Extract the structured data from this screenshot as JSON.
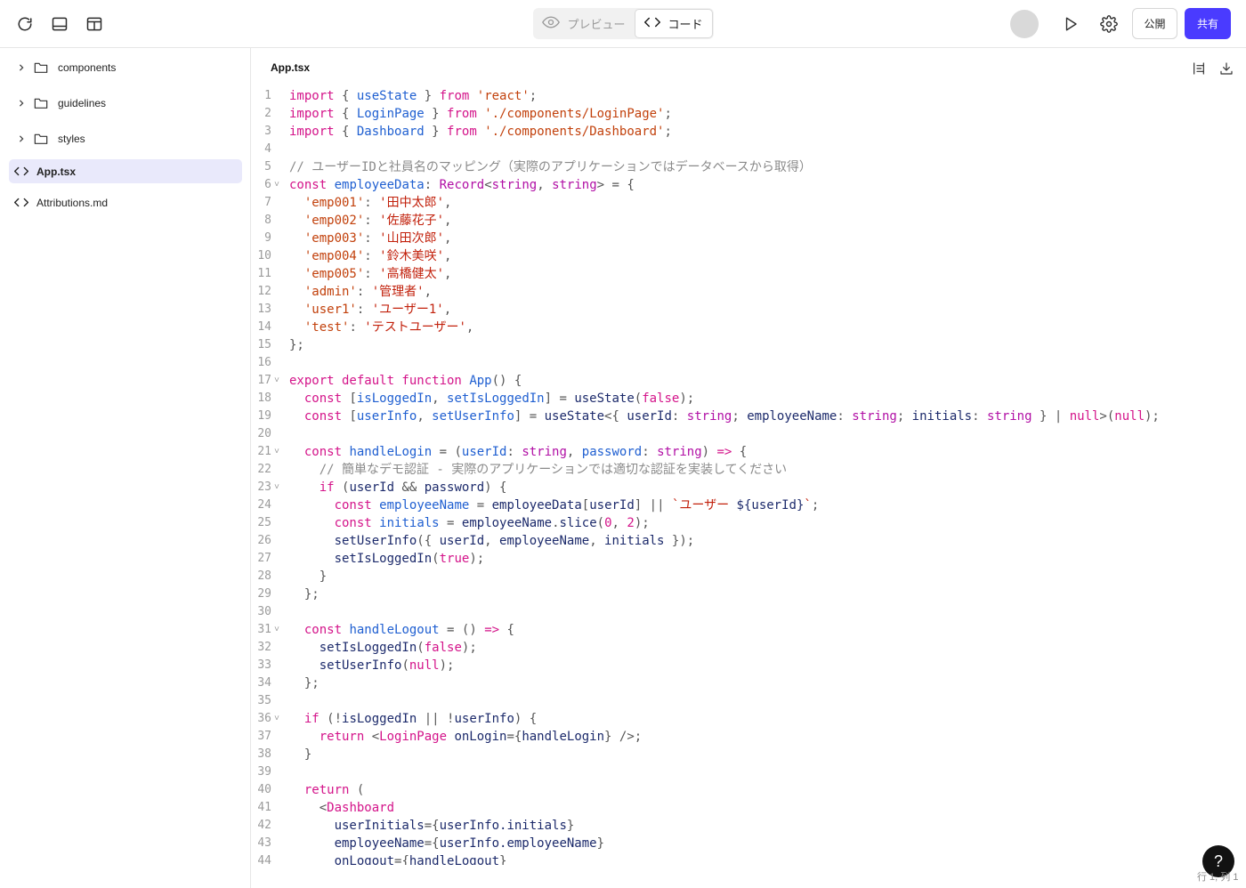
{
  "toolbar": {
    "preview_label": "プレビュー",
    "code_label": "コード",
    "publish_label": "公開",
    "share_label": "共有",
    "icons": [
      "refresh-icon",
      "panel-bottom-icon",
      "panel-split-icon",
      "eye-icon",
      "code-icon",
      "play-icon",
      "gear-icon"
    ]
  },
  "sidebar": {
    "items": [
      {
        "label": "components",
        "type": "folder",
        "expanded": false
      },
      {
        "label": "guidelines",
        "type": "folder",
        "expanded": false
      },
      {
        "label": "styles",
        "type": "folder",
        "expanded": false
      },
      {
        "label": "App.tsx",
        "type": "file",
        "active": true
      },
      {
        "label": "Attributions.md",
        "type": "file",
        "active": false
      }
    ]
  },
  "editor": {
    "filename": "App.tsx",
    "icons": [
      "format-icon",
      "download-icon"
    ],
    "lines": [
      {
        "n": "1",
        "fold": false,
        "tokens": [
          [
            "k",
            "import"
          ],
          [
            "p",
            " { "
          ],
          [
            "f",
            "useState"
          ],
          [
            "p",
            " } "
          ],
          [
            "k",
            "from"
          ],
          [
            "p",
            " "
          ],
          [
            "s",
            "'react'"
          ],
          [
            "p",
            ";"
          ]
        ]
      },
      {
        "n": "2",
        "fold": false,
        "tokens": [
          [
            "k",
            "import"
          ],
          [
            "p",
            " { "
          ],
          [
            "f",
            "LoginPage"
          ],
          [
            "p",
            " } "
          ],
          [
            "k",
            "from"
          ],
          [
            "p",
            " "
          ],
          [
            "s",
            "'./components/LoginPage'"
          ],
          [
            "p",
            ";"
          ]
        ]
      },
      {
        "n": "3",
        "fold": false,
        "tokens": [
          [
            "k",
            "import"
          ],
          [
            "p",
            " { "
          ],
          [
            "f",
            "Dashboard"
          ],
          [
            "p",
            " } "
          ],
          [
            "k",
            "from"
          ],
          [
            "p",
            " "
          ],
          [
            "s",
            "'./components/Dashboard'"
          ],
          [
            "p",
            ";"
          ]
        ]
      },
      {
        "n": "4",
        "fold": false,
        "tokens": []
      },
      {
        "n": "5",
        "fold": false,
        "tokens": [
          [
            "c",
            "// ユーザーIDと社員名のマッピング（実際のアプリケーションではデータベースから取得）"
          ]
        ]
      },
      {
        "n": "6",
        "fold": true,
        "tokens": [
          [
            "k",
            "const"
          ],
          [
            "p",
            " "
          ],
          [
            "f",
            "employeeData"
          ],
          [
            "p",
            ": "
          ],
          [
            "t",
            "Record"
          ],
          [
            "p",
            "<"
          ],
          [
            "t",
            "string"
          ],
          [
            "p",
            ", "
          ],
          [
            "t",
            "string"
          ],
          [
            "p",
            "> = {"
          ]
        ]
      },
      {
        "n": "7",
        "fold": false,
        "tokens": [
          [
            "p",
            "  "
          ],
          [
            "s",
            "'emp001'"
          ],
          [
            "p",
            ": "
          ],
          [
            "sj",
            "'田中太郎'"
          ],
          [
            "p",
            ","
          ]
        ]
      },
      {
        "n": "8",
        "fold": false,
        "tokens": [
          [
            "p",
            "  "
          ],
          [
            "s",
            "'emp002'"
          ],
          [
            "p",
            ": "
          ],
          [
            "sj",
            "'佐藤花子'"
          ],
          [
            "p",
            ","
          ]
        ]
      },
      {
        "n": "9",
        "fold": false,
        "tokens": [
          [
            "p",
            "  "
          ],
          [
            "s",
            "'emp003'"
          ],
          [
            "p",
            ": "
          ],
          [
            "sj",
            "'山田次郎'"
          ],
          [
            "p",
            ","
          ]
        ]
      },
      {
        "n": "10",
        "fold": false,
        "tokens": [
          [
            "p",
            "  "
          ],
          [
            "s",
            "'emp004'"
          ],
          [
            "p",
            ": "
          ],
          [
            "sj",
            "'鈴木美咲'"
          ],
          [
            "p",
            ","
          ]
        ]
      },
      {
        "n": "11",
        "fold": false,
        "tokens": [
          [
            "p",
            "  "
          ],
          [
            "s",
            "'emp005'"
          ],
          [
            "p",
            ": "
          ],
          [
            "sj",
            "'高橋健太'"
          ],
          [
            "p",
            ","
          ]
        ]
      },
      {
        "n": "12",
        "fold": false,
        "tokens": [
          [
            "p",
            "  "
          ],
          [
            "s",
            "'admin'"
          ],
          [
            "p",
            ": "
          ],
          [
            "sj",
            "'管理者'"
          ],
          [
            "p",
            ","
          ]
        ]
      },
      {
        "n": "13",
        "fold": false,
        "tokens": [
          [
            "p",
            "  "
          ],
          [
            "s",
            "'user1'"
          ],
          [
            "p",
            ": "
          ],
          [
            "sj",
            "'ユーザー1'"
          ],
          [
            "p",
            ","
          ]
        ]
      },
      {
        "n": "14",
        "fold": false,
        "tokens": [
          [
            "p",
            "  "
          ],
          [
            "s",
            "'test'"
          ],
          [
            "p",
            ": "
          ],
          [
            "sj",
            "'テストユーザー'"
          ],
          [
            "p",
            ","
          ]
        ]
      },
      {
        "n": "15",
        "fold": false,
        "tokens": [
          [
            "p",
            "};"
          ]
        ]
      },
      {
        "n": "16",
        "fold": false,
        "tokens": []
      },
      {
        "n": "17",
        "fold": true,
        "tokens": [
          [
            "k",
            "export default function"
          ],
          [
            "p",
            " "
          ],
          [
            "f",
            "App"
          ],
          [
            "p",
            "() {"
          ]
        ]
      },
      {
        "n": "18",
        "fold": false,
        "tokens": [
          [
            "p",
            "  "
          ],
          [
            "k",
            "const"
          ],
          [
            "p",
            " ["
          ],
          [
            "f",
            "isLoggedIn"
          ],
          [
            "p",
            ", "
          ],
          [
            "f",
            "setIsLoggedIn"
          ],
          [
            "p",
            "] = "
          ],
          [
            "v",
            "useState"
          ],
          [
            "p",
            "("
          ],
          [
            "n",
            "false"
          ],
          [
            "p",
            ");"
          ]
        ]
      },
      {
        "n": "19",
        "fold": false,
        "tokens": [
          [
            "p",
            "  "
          ],
          [
            "k",
            "const"
          ],
          [
            "p",
            " ["
          ],
          [
            "f",
            "userInfo"
          ],
          [
            "p",
            ", "
          ],
          [
            "f",
            "setUserInfo"
          ],
          [
            "p",
            "] = "
          ],
          [
            "v",
            "useState"
          ],
          [
            "p",
            "<{ "
          ],
          [
            "v",
            "userId"
          ],
          [
            "p",
            ": "
          ],
          [
            "t",
            "string"
          ],
          [
            "p",
            "; "
          ],
          [
            "v",
            "employeeName"
          ],
          [
            "p",
            ": "
          ],
          [
            "t",
            "string"
          ],
          [
            "p",
            "; "
          ],
          [
            "v",
            "initials"
          ],
          [
            "p",
            ": "
          ],
          [
            "t",
            "string"
          ],
          [
            "p",
            " } | "
          ],
          [
            "n",
            "null"
          ],
          [
            "p",
            ">("
          ],
          [
            "n",
            "null"
          ],
          [
            "p",
            ");"
          ]
        ]
      },
      {
        "n": "20",
        "fold": false,
        "tokens": []
      },
      {
        "n": "21",
        "fold": true,
        "tokens": [
          [
            "p",
            "  "
          ],
          [
            "k",
            "const"
          ],
          [
            "p",
            " "
          ],
          [
            "f",
            "handleLogin"
          ],
          [
            "p",
            " = ("
          ],
          [
            "f",
            "userId"
          ],
          [
            "p",
            ": "
          ],
          [
            "t",
            "string"
          ],
          [
            "p",
            ", "
          ],
          [
            "f",
            "password"
          ],
          [
            "p",
            ": "
          ],
          [
            "t",
            "string"
          ],
          [
            "p",
            ") "
          ],
          [
            "k",
            "=>"
          ],
          [
            "p",
            " {"
          ]
        ]
      },
      {
        "n": "22",
        "fold": false,
        "tokens": [
          [
            "p",
            "    "
          ],
          [
            "c",
            "// 簡単なデモ認証 - 実際のアプリケーションでは適切な認証を実装してください"
          ]
        ]
      },
      {
        "n": "23",
        "fold": true,
        "tokens": [
          [
            "p",
            "    "
          ],
          [
            "k",
            "if"
          ],
          [
            "p",
            " ("
          ],
          [
            "v",
            "userId"
          ],
          [
            "p",
            " && "
          ],
          [
            "v",
            "password"
          ],
          [
            "p",
            ") {"
          ]
        ]
      },
      {
        "n": "24",
        "fold": false,
        "tokens": [
          [
            "p",
            "      "
          ],
          [
            "k",
            "const"
          ],
          [
            "p",
            " "
          ],
          [
            "f",
            "employeeName"
          ],
          [
            "p",
            " = "
          ],
          [
            "v",
            "employeeData"
          ],
          [
            "p",
            "["
          ],
          [
            "v",
            "userId"
          ],
          [
            "p",
            "] || "
          ],
          [
            "sj",
            "`ユーザー "
          ],
          [
            "v",
            "${userId}"
          ],
          [
            "sj",
            "`"
          ],
          [
            "p",
            ";"
          ]
        ]
      },
      {
        "n": "25",
        "fold": false,
        "tokens": [
          [
            "p",
            "      "
          ],
          [
            "k",
            "const"
          ],
          [
            "p",
            " "
          ],
          [
            "f",
            "initials"
          ],
          [
            "p",
            " = "
          ],
          [
            "v",
            "employeeName"
          ],
          [
            "p",
            "."
          ],
          [
            "v",
            "slice"
          ],
          [
            "p",
            "("
          ],
          [
            "n",
            "0"
          ],
          [
            "p",
            ", "
          ],
          [
            "n",
            "2"
          ],
          [
            "p",
            ");"
          ]
        ]
      },
      {
        "n": "26",
        "fold": false,
        "tokens": [
          [
            "p",
            "      "
          ],
          [
            "v",
            "setUserInfo"
          ],
          [
            "p",
            "({ "
          ],
          [
            "v",
            "userId"
          ],
          [
            "p",
            ", "
          ],
          [
            "v",
            "employeeName"
          ],
          [
            "p",
            ", "
          ],
          [
            "v",
            "initials"
          ],
          [
            "p",
            " });"
          ]
        ]
      },
      {
        "n": "27",
        "fold": false,
        "tokens": [
          [
            "p",
            "      "
          ],
          [
            "v",
            "setIsLoggedIn"
          ],
          [
            "p",
            "("
          ],
          [
            "n",
            "true"
          ],
          [
            "p",
            ");"
          ]
        ]
      },
      {
        "n": "28",
        "fold": false,
        "tokens": [
          [
            "p",
            "    }"
          ]
        ]
      },
      {
        "n": "29",
        "fold": false,
        "tokens": [
          [
            "p",
            "  };"
          ]
        ]
      },
      {
        "n": "30",
        "fold": false,
        "tokens": []
      },
      {
        "n": "31",
        "fold": true,
        "tokens": [
          [
            "p",
            "  "
          ],
          [
            "k",
            "const"
          ],
          [
            "p",
            " "
          ],
          [
            "f",
            "handleLogout"
          ],
          [
            "p",
            " = () "
          ],
          [
            "k",
            "=>"
          ],
          [
            "p",
            " {"
          ]
        ]
      },
      {
        "n": "32",
        "fold": false,
        "tokens": [
          [
            "p",
            "    "
          ],
          [
            "v",
            "setIsLoggedIn"
          ],
          [
            "p",
            "("
          ],
          [
            "n",
            "false"
          ],
          [
            "p",
            ");"
          ]
        ]
      },
      {
        "n": "33",
        "fold": false,
        "tokens": [
          [
            "p",
            "    "
          ],
          [
            "v",
            "setUserInfo"
          ],
          [
            "p",
            "("
          ],
          [
            "n",
            "null"
          ],
          [
            "p",
            ");"
          ]
        ]
      },
      {
        "n": "34",
        "fold": false,
        "tokens": [
          [
            "p",
            "  };"
          ]
        ]
      },
      {
        "n": "35",
        "fold": false,
        "tokens": []
      },
      {
        "n": "36",
        "fold": true,
        "tokens": [
          [
            "p",
            "  "
          ],
          [
            "k",
            "if"
          ],
          [
            "p",
            " (!"
          ],
          [
            "v",
            "isLoggedIn"
          ],
          [
            "p",
            " || !"
          ],
          [
            "v",
            "userInfo"
          ],
          [
            "p",
            ") {"
          ]
        ]
      },
      {
        "n": "37",
        "fold": false,
        "tokens": [
          [
            "p",
            "    "
          ],
          [
            "k",
            "return"
          ],
          [
            "p",
            " <"
          ],
          [
            "k",
            "LoginPage"
          ],
          [
            "p",
            " "
          ],
          [
            "v",
            "onLogin"
          ],
          [
            "p",
            "={"
          ],
          [
            "v",
            "handleLogin"
          ],
          [
            "p",
            "} />;"
          ]
        ]
      },
      {
        "n": "38",
        "fold": false,
        "tokens": [
          [
            "p",
            "  }"
          ]
        ]
      },
      {
        "n": "39",
        "fold": false,
        "tokens": []
      },
      {
        "n": "40",
        "fold": false,
        "tokens": [
          [
            "p",
            "  "
          ],
          [
            "k",
            "return"
          ],
          [
            "p",
            " ("
          ]
        ]
      },
      {
        "n": "41",
        "fold": false,
        "tokens": [
          [
            "p",
            "    <"
          ],
          [
            "k",
            "Dashboard"
          ]
        ]
      },
      {
        "n": "42",
        "fold": false,
        "tokens": [
          [
            "p",
            "      "
          ],
          [
            "v",
            "userInitials"
          ],
          [
            "p",
            "={"
          ],
          [
            "v",
            "userInfo.initials"
          ],
          [
            "p",
            "}"
          ]
        ]
      },
      {
        "n": "43",
        "fold": false,
        "tokens": [
          [
            "p",
            "      "
          ],
          [
            "v",
            "employeeName"
          ],
          [
            "p",
            "={"
          ],
          [
            "v",
            "userInfo.employeeName"
          ],
          [
            "p",
            "}"
          ]
        ]
      },
      {
        "n": "44",
        "fold": false,
        "tokens": [
          [
            "p",
            "      "
          ],
          [
            "v",
            "onLogout"
          ],
          [
            "p",
            "={"
          ],
          [
            "v",
            "handleLogout"
          ],
          [
            "p",
            "}"
          ]
        ]
      }
    ]
  },
  "status": {
    "cursor": "行 1, 列 1"
  },
  "help_label": "?",
  "colors": {
    "accent": "#4a3bff",
    "active_row": "#e9e9fb"
  }
}
